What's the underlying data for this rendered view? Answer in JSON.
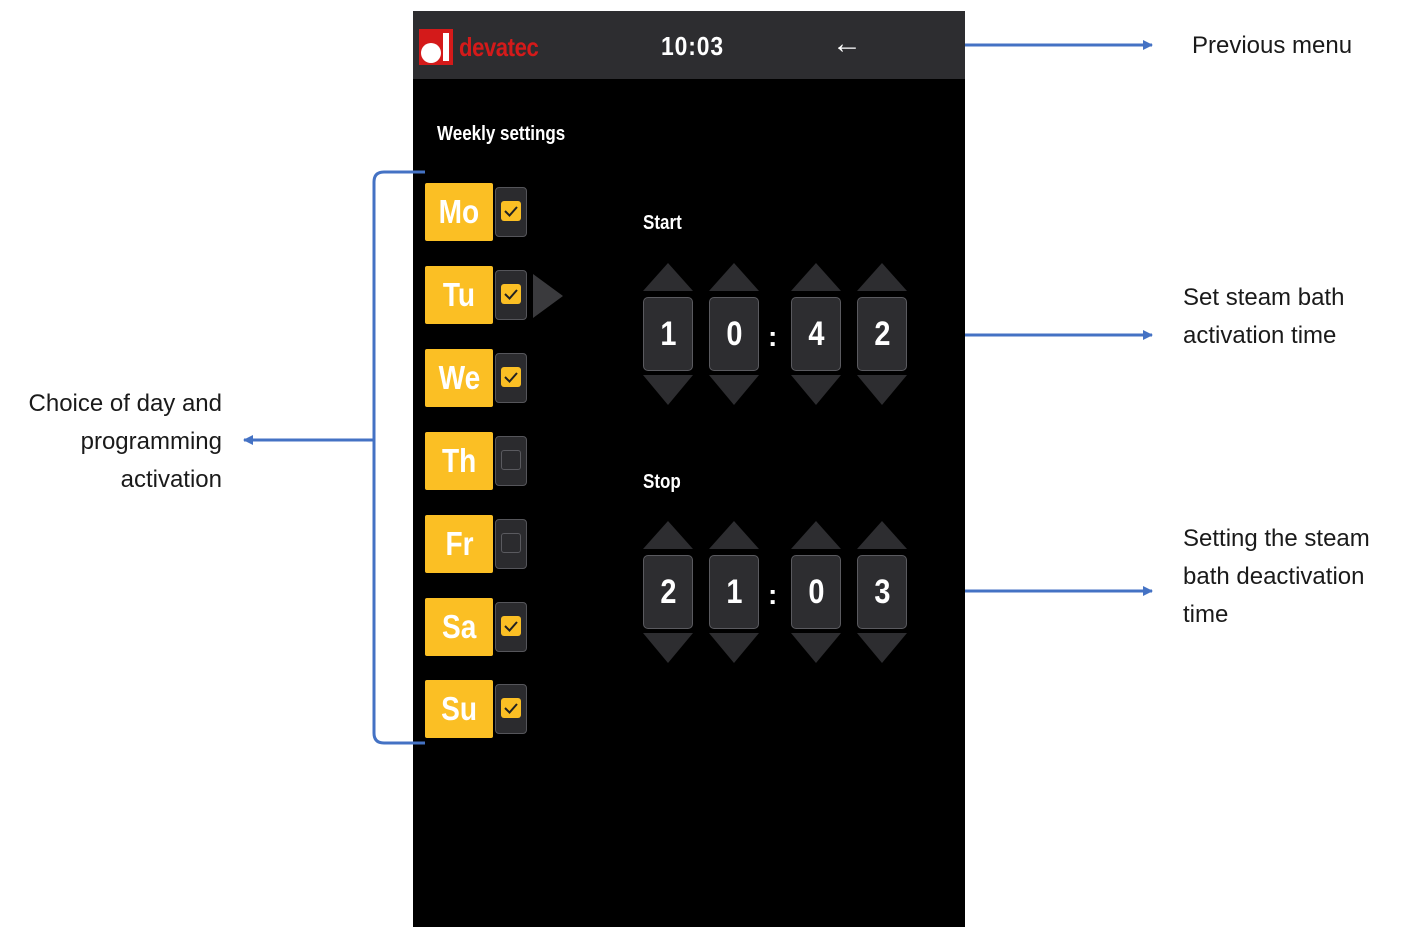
{
  "header": {
    "brand": "devatec",
    "time": "10:03",
    "back_icon": "←"
  },
  "weekly": {
    "title": "Weekly settings",
    "days": [
      {
        "label": "Mo",
        "checked": true
      },
      {
        "label": "Tu",
        "checked": true
      },
      {
        "label": "We",
        "checked": true
      },
      {
        "label": "Th",
        "checked": false
      },
      {
        "label": "Fr",
        "checked": false
      },
      {
        "label": "Sa",
        "checked": true
      },
      {
        "label": "Su",
        "checked": true
      }
    ]
  },
  "start": {
    "label": "Start",
    "digits": [
      "1",
      "0",
      "4",
      "2"
    ],
    "separator": ":"
  },
  "stop": {
    "label": "Stop",
    "digits": [
      "2",
      "1",
      "0",
      "3"
    ],
    "separator": ":"
  },
  "annotations": {
    "previous_menu": "Previous menu",
    "start_line1": "Set steam bath",
    "start_line2": "activation time",
    "stop_line1": "Setting the steam",
    "stop_line2": "bath deactivation",
    "stop_line3": "time",
    "day_line1": "Choice of day and",
    "day_line2": "programming",
    "day_line3": "activation"
  },
  "colors": {
    "accent": "#fbbf24",
    "brand_red": "#d41a1a",
    "annotation_blue": "#4472c4",
    "screen_bg": "#000000",
    "topbar_bg": "#2d2d30"
  }
}
